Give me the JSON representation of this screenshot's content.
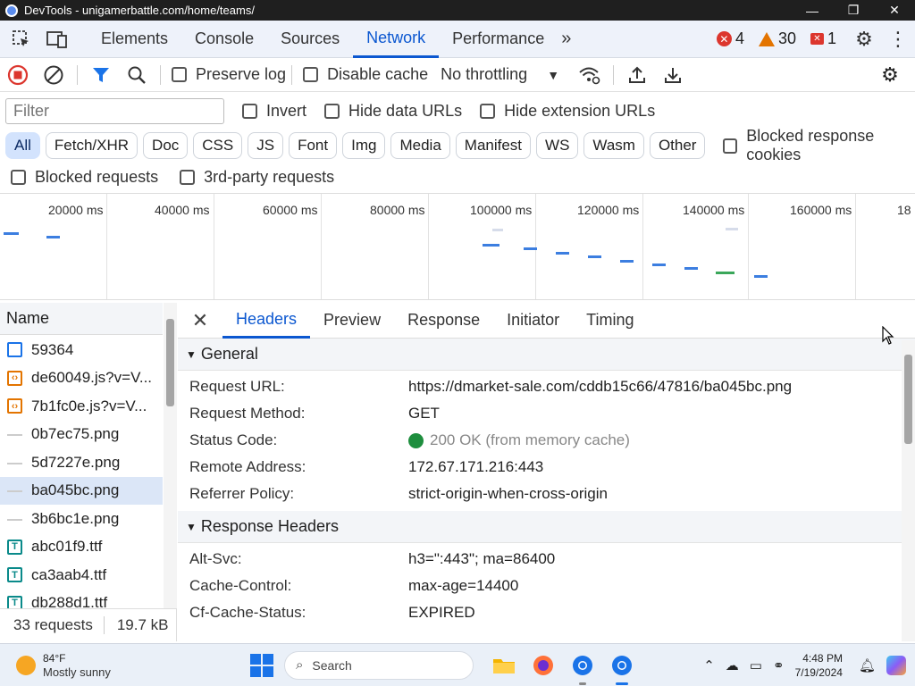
{
  "window": {
    "title": "DevTools - unigamerbattle.com/home/teams/",
    "minimize": "—",
    "maximize": "❐",
    "close": "✕"
  },
  "main_tabs": [
    {
      "label": "Elements",
      "active": false
    },
    {
      "label": "Console",
      "active": false
    },
    {
      "label": "Sources",
      "active": false
    },
    {
      "label": "Network",
      "active": true
    },
    {
      "label": "Performance",
      "active": false
    }
  ],
  "more_tabs": "»",
  "counts": {
    "errors": "4",
    "warnings": "30",
    "issues": "1"
  },
  "toolbar": {
    "preserve_log": "Preserve log",
    "disable_cache": "Disable cache",
    "throttling": "No throttling"
  },
  "filter": {
    "placeholder": "Filter",
    "invert": "Invert",
    "hide_data_urls": "Hide data URLs",
    "hide_extension_urls": "Hide extension URLs"
  },
  "type_chips": [
    {
      "label": "All",
      "active": true
    },
    {
      "label": "Fetch/XHR",
      "active": false
    },
    {
      "label": "Doc",
      "active": false
    },
    {
      "label": "CSS",
      "active": false
    },
    {
      "label": "JS",
      "active": false
    },
    {
      "label": "Font",
      "active": false
    },
    {
      "label": "Img",
      "active": false
    },
    {
      "label": "Media",
      "active": false
    },
    {
      "label": "Manifest",
      "active": false
    },
    {
      "label": "WS",
      "active": false
    },
    {
      "label": "Wasm",
      "active": false
    },
    {
      "label": "Other",
      "active": false
    }
  ],
  "blocked_response_cookies": "Blocked response cookies",
  "blocked_requests": "Blocked requests",
  "third_party_requests": "3rd-party requests",
  "overview": {
    "ticks": [
      "20000 ms",
      "40000 ms",
      "60000 ms",
      "80000 ms",
      "100000 ms",
      "120000 ms",
      "140000 ms",
      "160000 ms",
      "18"
    ]
  },
  "requests": {
    "header": "Name",
    "items": [
      {
        "name": "59364",
        "type": "doc",
        "selected": false
      },
      {
        "name": "de60049.js?v=V...",
        "type": "js",
        "selected": false
      },
      {
        "name": "7b1fc0e.js?v=V...",
        "type": "js",
        "selected": false
      },
      {
        "name": "0b7ec75.png",
        "type": "img",
        "selected": false
      },
      {
        "name": "5d7227e.png",
        "type": "img",
        "selected": false
      },
      {
        "name": "ba045bc.png",
        "type": "img",
        "selected": true
      },
      {
        "name": "3b6bc1e.png",
        "type": "img",
        "selected": false
      },
      {
        "name": "abc01f9.ttf",
        "type": "font",
        "selected": false
      },
      {
        "name": "ca3aab4.ttf",
        "type": "font",
        "selected": false
      },
      {
        "name": "db288d1.ttf",
        "type": "font",
        "selected": false
      }
    ],
    "count": "33 requests",
    "size": "19.7 kB"
  },
  "details": {
    "close": "✕",
    "tabs": [
      {
        "label": "Headers",
        "active": true
      },
      {
        "label": "Preview",
        "active": false
      },
      {
        "label": "Response",
        "active": false
      },
      {
        "label": "Initiator",
        "active": false
      },
      {
        "label": "Timing",
        "active": false
      }
    ],
    "general_title": "General",
    "general": [
      {
        "key": "Request URL:",
        "value": "https://dmarket-sale.com/cddb15c66/47816/ba045bc.png"
      },
      {
        "key": "Request Method:",
        "value": "GET"
      },
      {
        "key": "Status Code:",
        "value": "200 OK (from memory cache)"
      },
      {
        "key": "Remote Address:",
        "value": "172.67.171.216:443"
      },
      {
        "key": "Referrer Policy:",
        "value": "strict-origin-when-cross-origin"
      }
    ],
    "response_title": "Response Headers",
    "response": [
      {
        "key": "Alt-Svc:",
        "value": "h3=\":443\"; ma=86400"
      },
      {
        "key": "Cache-Control:",
        "value": "max-age=14400"
      },
      {
        "key": "Cf-Cache-Status:",
        "value": "EXPIRED"
      }
    ]
  },
  "taskbar": {
    "temp": "84°F",
    "condition": "Mostly sunny",
    "search": "Search",
    "time": "4:48 PM",
    "date": "7/19/2024"
  },
  "colors": {
    "accent": "#0b57d0",
    "error": "#dc362e",
    "warning": "#e37400",
    "ok": "#1e8e3e"
  }
}
